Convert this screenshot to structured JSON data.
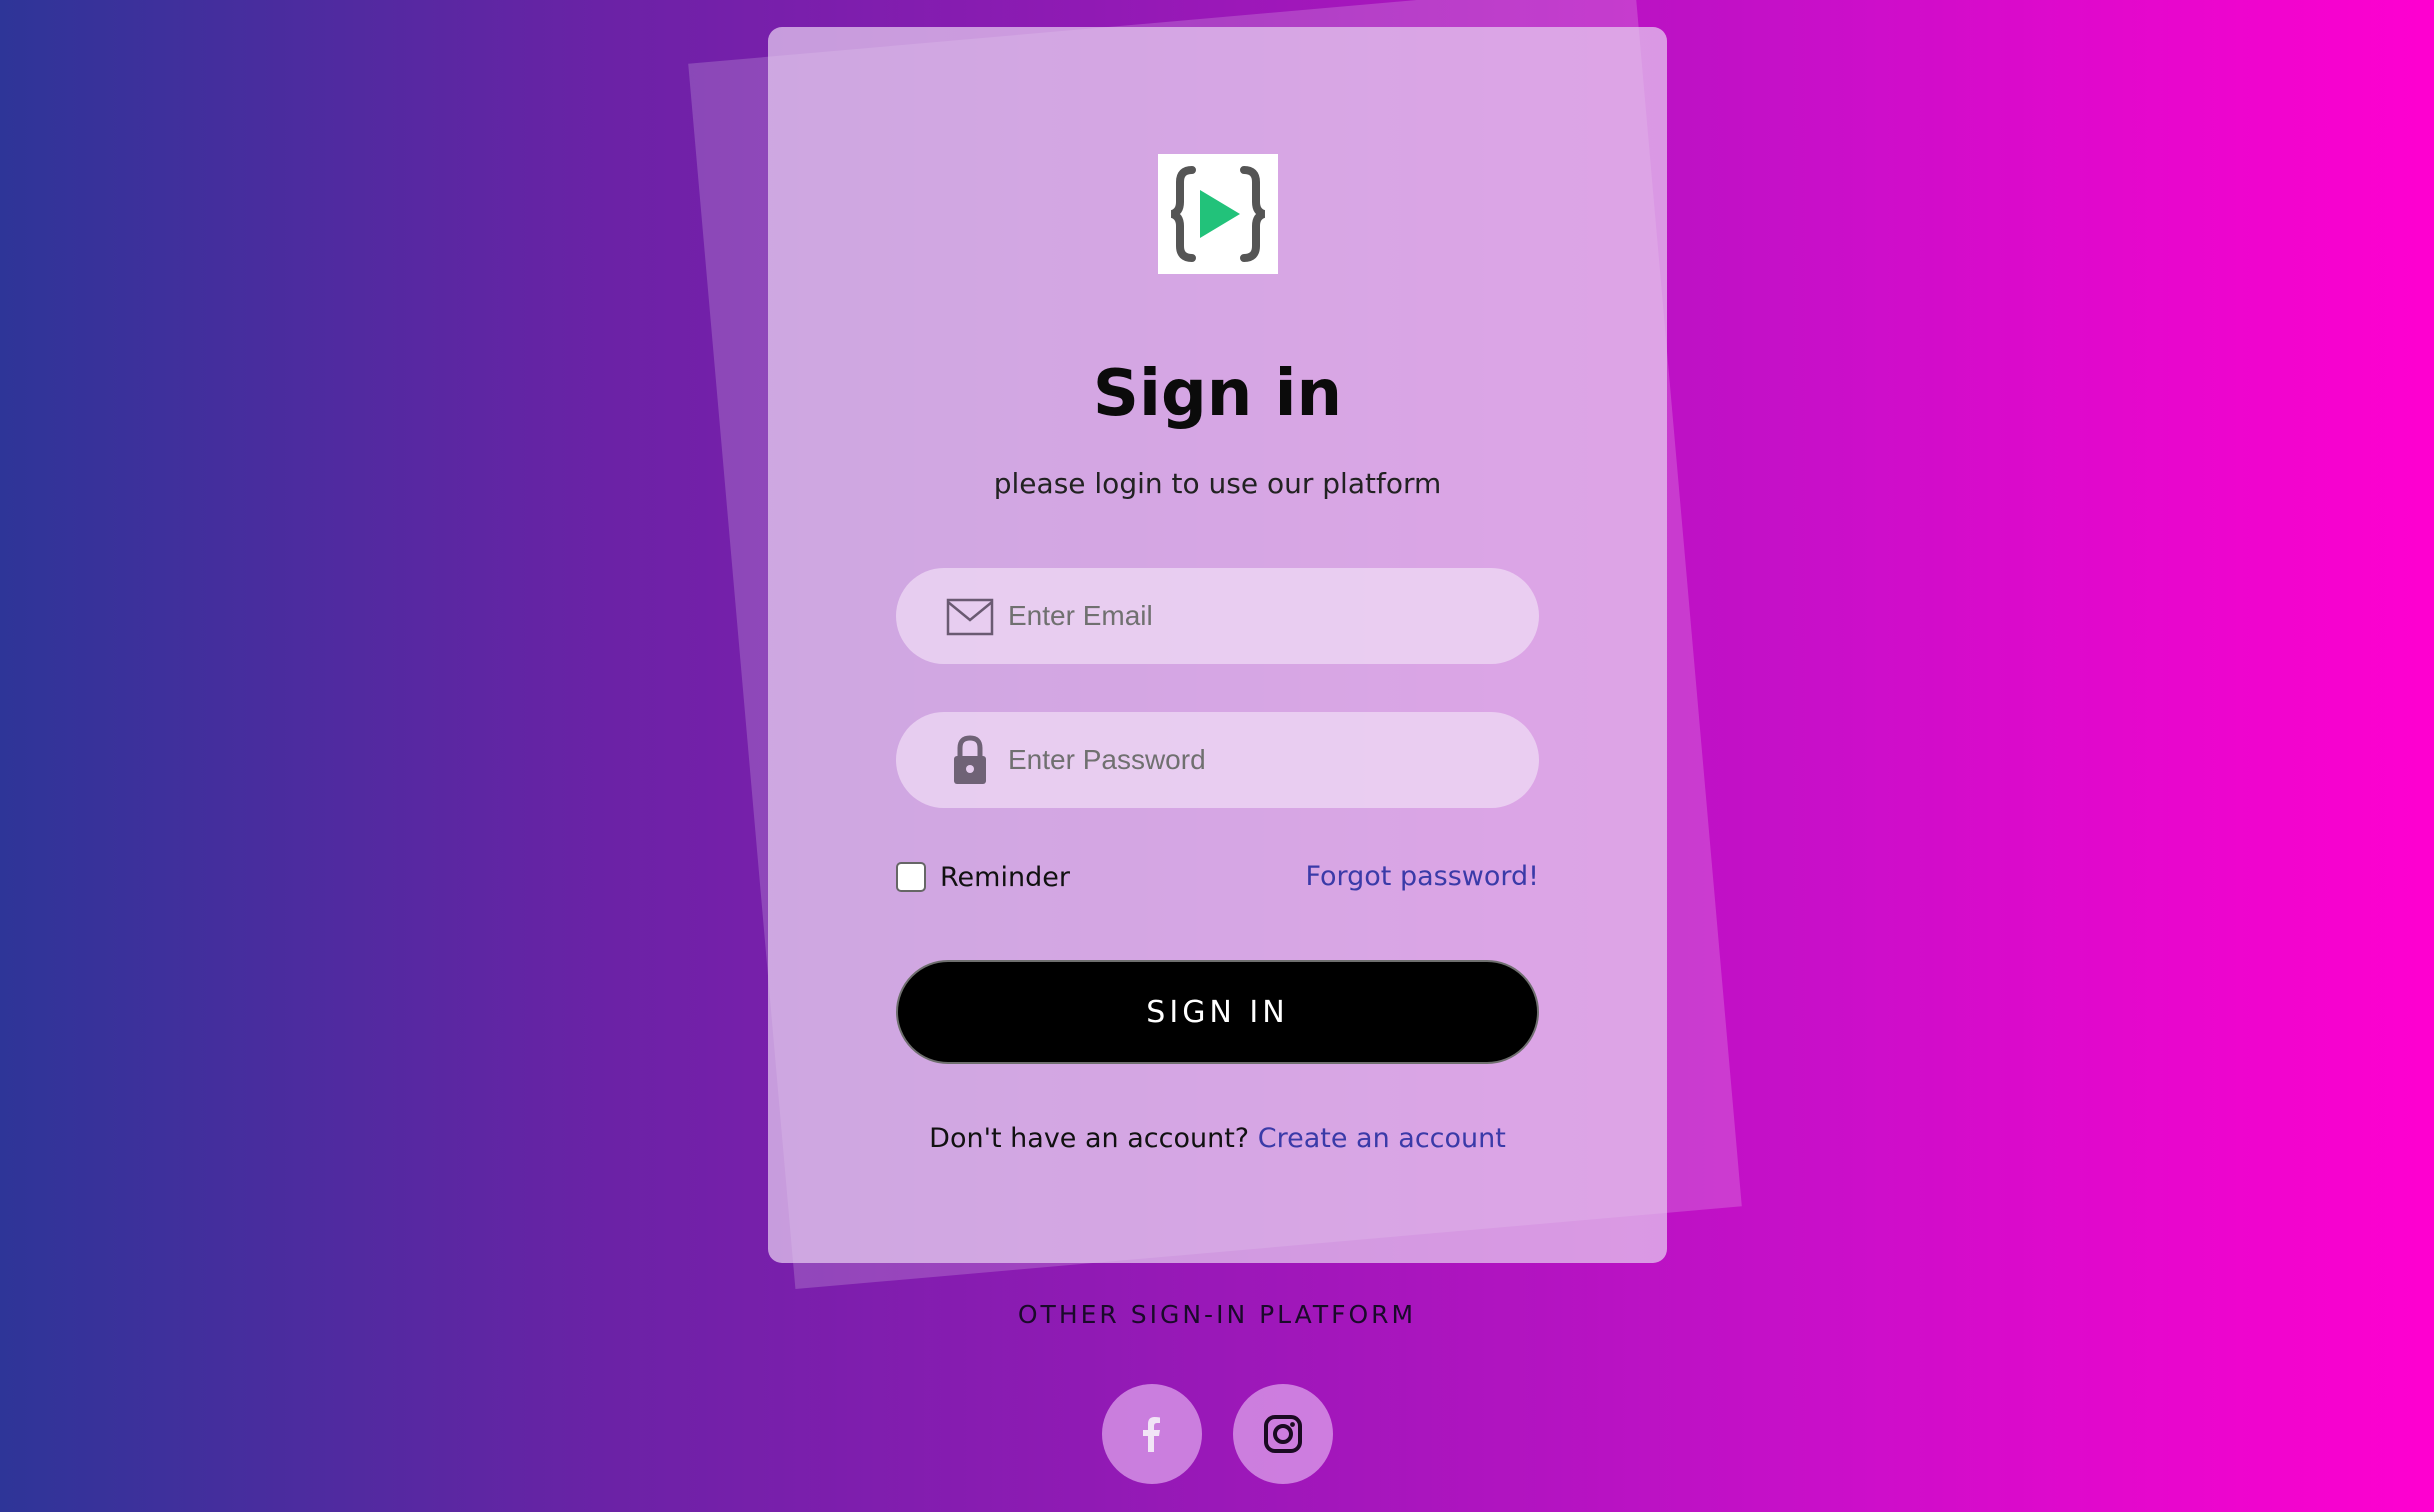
{
  "login": {
    "title": "Sign in",
    "subtitle": "please login to use our platform",
    "email_placeholder": "Enter Email",
    "password_placeholder": "Enter Password",
    "reminder_label": "Reminder",
    "forgot_link": "Forgot password!",
    "signin_button": "SIGN IN",
    "no_account_text": "Don't have an account?",
    "create_account_link": "Create an account"
  },
  "other_platforms": {
    "heading": "OTHER SIGN-IN PLATFORM",
    "icons": [
      "facebook-icon",
      "instagram-icon"
    ]
  },
  "colors": {
    "accent_link": "#3a3aa8",
    "button_bg": "#000000",
    "logo_play": "#22c27a",
    "gradient_start": "#2e3598",
    "gradient_end": "#ff00d0"
  }
}
